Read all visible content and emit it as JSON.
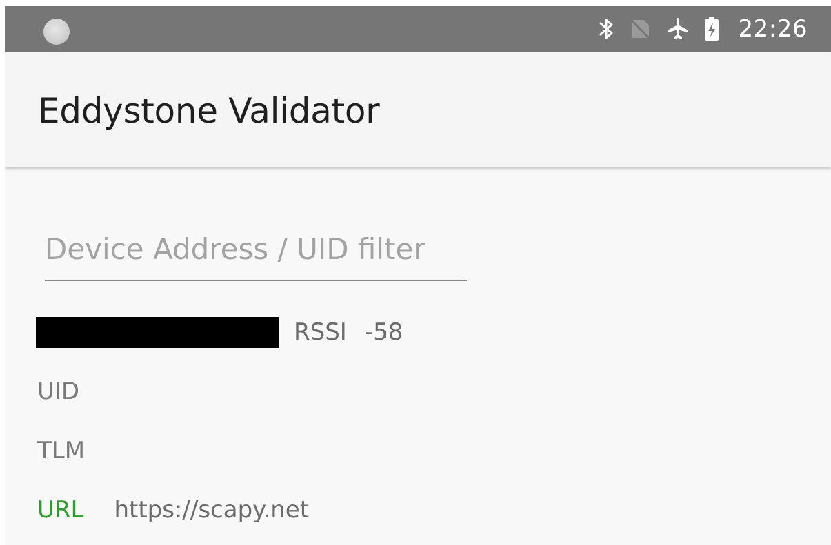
{
  "status_bar": {
    "time": "22:26",
    "icons": [
      "notification-dot-icon",
      "bluetooth-icon",
      "no-sim-icon",
      "airplane-icon",
      "battery-charging-icon"
    ]
  },
  "app_bar": {
    "title": "Eddystone Validator"
  },
  "filter": {
    "placeholder": "Device Address / UID filter",
    "value": ""
  },
  "device": {
    "address_redacted": true,
    "rssi_label": "RSSI",
    "rssi_value": "-58",
    "frames": {
      "uid_label": "UID",
      "tlm_label": "TLM",
      "url_label": "URL",
      "url_value": "https://scapy.net"
    }
  },
  "colors": {
    "status_bar": "#757675",
    "background": "#f7f8f7",
    "url_accent": "#2c9d2c"
  }
}
